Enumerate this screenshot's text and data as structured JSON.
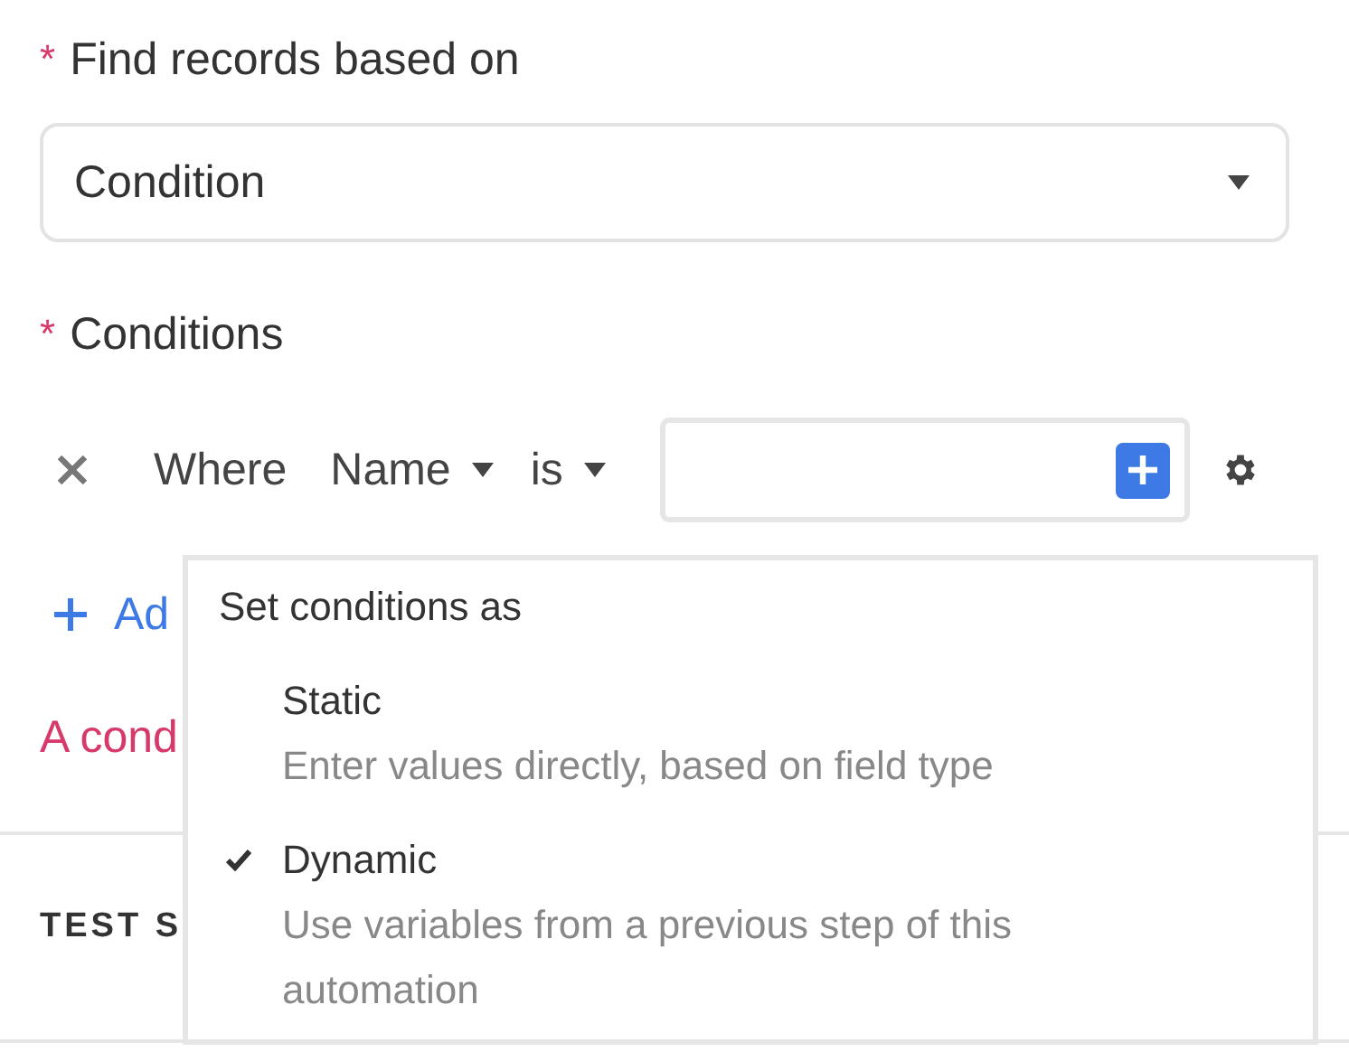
{
  "find_field": {
    "label": "Find records based on",
    "required_mark": "*",
    "value": "Condition"
  },
  "conditions": {
    "label": "Conditions",
    "required_mark": "*",
    "row": {
      "prefix": "Where",
      "field": "Name",
      "operator": "is"
    },
    "add_link": "Ad",
    "error": "A cond"
  },
  "test_section": {
    "title": "TEST S"
  },
  "menu": {
    "title": "Set conditions as",
    "options": [
      {
        "label": "Static",
        "description": "Enter values directly, based on field type",
        "selected": false
      },
      {
        "label": "Dynamic",
        "description": "Use variables from a previous step of this automation",
        "selected": true
      }
    ]
  }
}
